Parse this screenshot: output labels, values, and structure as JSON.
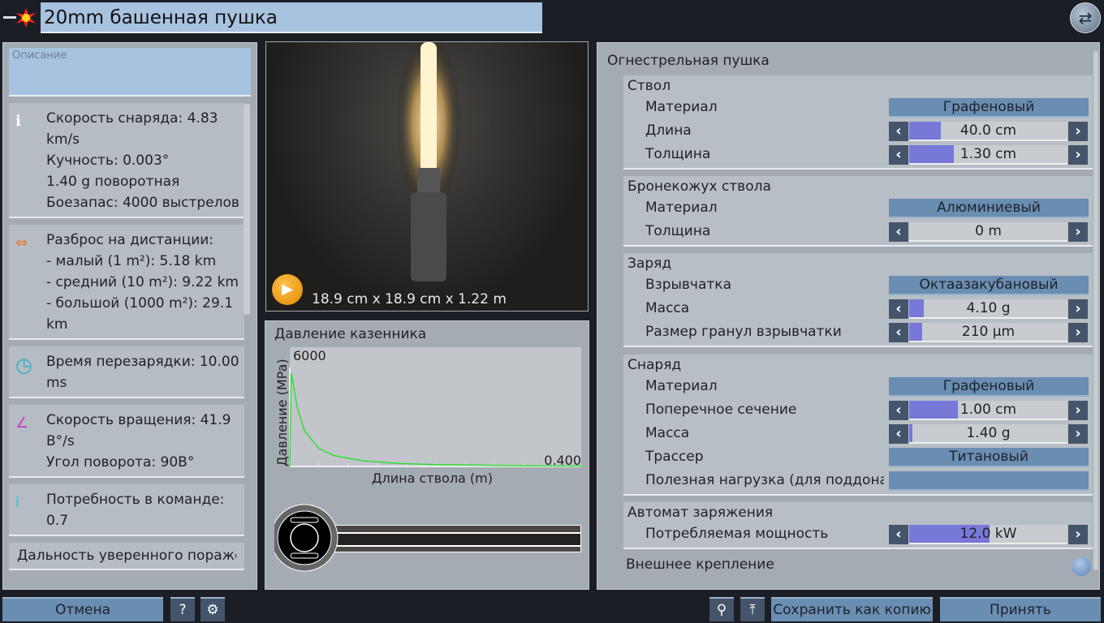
{
  "header": {
    "title": "20mm башенная пушка"
  },
  "left": {
    "description_placeholder": "Описание",
    "cards": [
      {
        "icon": "info-icon",
        "text": "Скорость снаряда: 4.83\nkm/s\nКучность: 0.003°\n1.40 g поворотная\nБоезапас: 4000 выстрелов"
      },
      {
        "icon": "spread-arrows-icon",
        "text": "Разброс на дистанции:\n- малый (1 m²): 5.18 km\n- средний (10 m²): 9.22 km\n- большой (1000 m²): 29.1\nkm"
      },
      {
        "icon": "clock-icon",
        "text": "Время перезарядки: 10.00\nms"
      },
      {
        "icon": "rotation-angle-icon",
        "text": "Скорость вращения: 41.9\nB°/s\nУгол поворота: 90B°"
      },
      {
        "icon": "crew-icon",
        "text": "Потребность в команде:\n0.7"
      }
    ],
    "last_item": "Дальность уверенного пораже"
  },
  "preview": {
    "dimensions": "18.9 cm x 18.9 cm x 1.22 m"
  },
  "pressure": {
    "title": "Давление казенника"
  },
  "chart_data": {
    "type": "line",
    "title": "Давление казенника",
    "xlabel": "Длина ствола (m)",
    "ylabel": "Давление (MPa)",
    "xlim": [
      0,
      0.4
    ],
    "ylim": [
      0,
      6000
    ],
    "ymax_label": "6000",
    "xmax_label": "0.400",
    "color": "#33dd33",
    "x": [
      0,
      0.002,
      0.005,
      0.01,
      0.02,
      0.04,
      0.06,
      0.1,
      0.15,
      0.2,
      0.3,
      0.4
    ],
    "y": [
      0,
      4700,
      4100,
      3000,
      1800,
      900,
      550,
      280,
      150,
      90,
      40,
      20
    ]
  },
  "right": {
    "title": "Огнестрельная пушка",
    "groups": [
      {
        "title": "Ствол",
        "rows": [
          {
            "label": "Материал",
            "type": "select",
            "value": "Графеновый"
          },
          {
            "label": "Длина",
            "type": "slider",
            "value": "40.0 cm",
            "fill": 0.2
          },
          {
            "label": "Толщина",
            "type": "slider",
            "value": "1.30 cm",
            "fill": 0.28
          }
        ]
      },
      {
        "title": "Бронекожух ствола",
        "rows": [
          {
            "label": "Материал",
            "type": "select",
            "value": "Алюминиевый"
          },
          {
            "label": "Толщина",
            "type": "slider",
            "value": "0 m",
            "fill": 0
          }
        ]
      },
      {
        "title": "Заряд",
        "rows": [
          {
            "label": "Взрывчатка",
            "type": "select",
            "value": "Октаазакубановый"
          },
          {
            "label": "Масса",
            "type": "slider",
            "value": "4.10 g",
            "fill": 0.09
          },
          {
            "label": "Размер гранул взрывчатки",
            "type": "slider",
            "value": "210 μm",
            "fill": 0.08
          }
        ]
      },
      {
        "title": "Снаряд",
        "rows": [
          {
            "label": "Материал",
            "type": "select",
            "value": "Графеновый"
          },
          {
            "label": "Поперечное сечение",
            "type": "slider",
            "value": "1.00 cm",
            "fill": 0.31
          },
          {
            "label": "Масса",
            "type": "slider",
            "value": "1.40 g",
            "fill": 0.02
          },
          {
            "label": "Трассер",
            "type": "select",
            "value": "Титановый"
          },
          {
            "label": "Полезная нагрузка (для поддона)",
            "type": "select",
            "value": ""
          }
        ]
      },
      {
        "title": "Автомат заряжения",
        "rows": [
          {
            "label": "Потребляемая мощность",
            "type": "slider",
            "value": "12.0 kW",
            "fill": 0.51
          }
        ]
      }
    ],
    "external_mount": "Внешнее крепление"
  },
  "footer": {
    "cancel": "Отмена",
    "help": "?",
    "save_copy": "Сохранить как копию",
    "accept": "Принять"
  }
}
